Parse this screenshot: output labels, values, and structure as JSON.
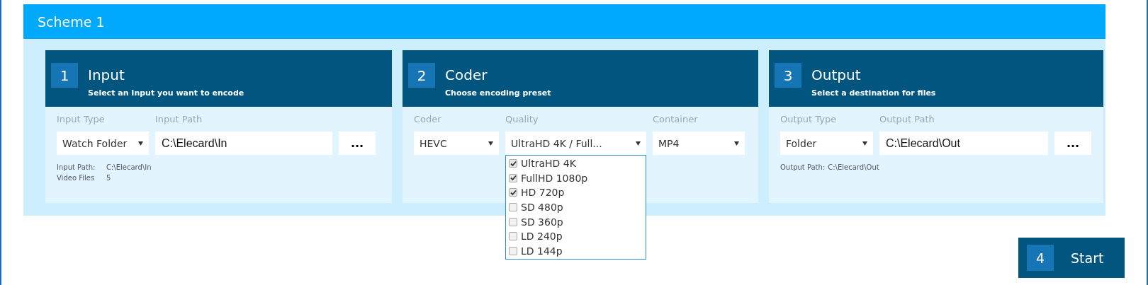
{
  "scheme": {
    "title": "Scheme 1"
  },
  "steps": [
    {
      "number": "1",
      "title": "Input",
      "subtitle": "Select an Input you want to encode",
      "fields": [
        {
          "kind": "select",
          "label": "Input Type",
          "value": "Watch Folder"
        },
        {
          "kind": "text",
          "label": "Input Path",
          "value": "C:\\Elecard\\In"
        },
        {
          "kind": "browse",
          "value": "..."
        }
      ],
      "info": [
        {
          "label": "Input Path:",
          "value": "C:\\Elecard\\In"
        },
        {
          "label": "Video Files",
          "value": "5"
        }
      ]
    },
    {
      "number": "2",
      "title": "Coder",
      "subtitle": "Choose encoding preset",
      "fields": [
        {
          "kind": "select",
          "label": "Coder",
          "value": "HEVC"
        },
        {
          "kind": "select",
          "label": "Quality",
          "value": "UltraHD 4K / Full...",
          "options": [
            {
              "label": "UltraHD 4K",
              "checked": true
            },
            {
              "label": "FullHD 1080p",
              "checked": true
            },
            {
              "label": "HD 720p",
              "checked": true
            },
            {
              "label": "SD 480p",
              "checked": false
            },
            {
              "label": "SD 360p",
              "checked": false
            },
            {
              "label": "LD 240p",
              "checked": false
            },
            {
              "label": "LD 144p",
              "checked": false
            }
          ]
        },
        {
          "kind": "select",
          "label": "Container",
          "value": "MP4"
        }
      ]
    },
    {
      "number": "3",
      "title": "Output",
      "subtitle": "Select a destination for files",
      "fields": [
        {
          "kind": "select",
          "label": "Output Type",
          "value": "Folder"
        },
        {
          "kind": "text",
          "label": "Output Path",
          "value": "C:\\Elecard\\Out"
        },
        {
          "kind": "browse",
          "value": "..."
        }
      ],
      "info": [
        {
          "label": "Output Path:",
          "value": "C:\\Elecard\\Out"
        }
      ]
    }
  ],
  "start": {
    "number": "4",
    "label": "Start"
  }
}
